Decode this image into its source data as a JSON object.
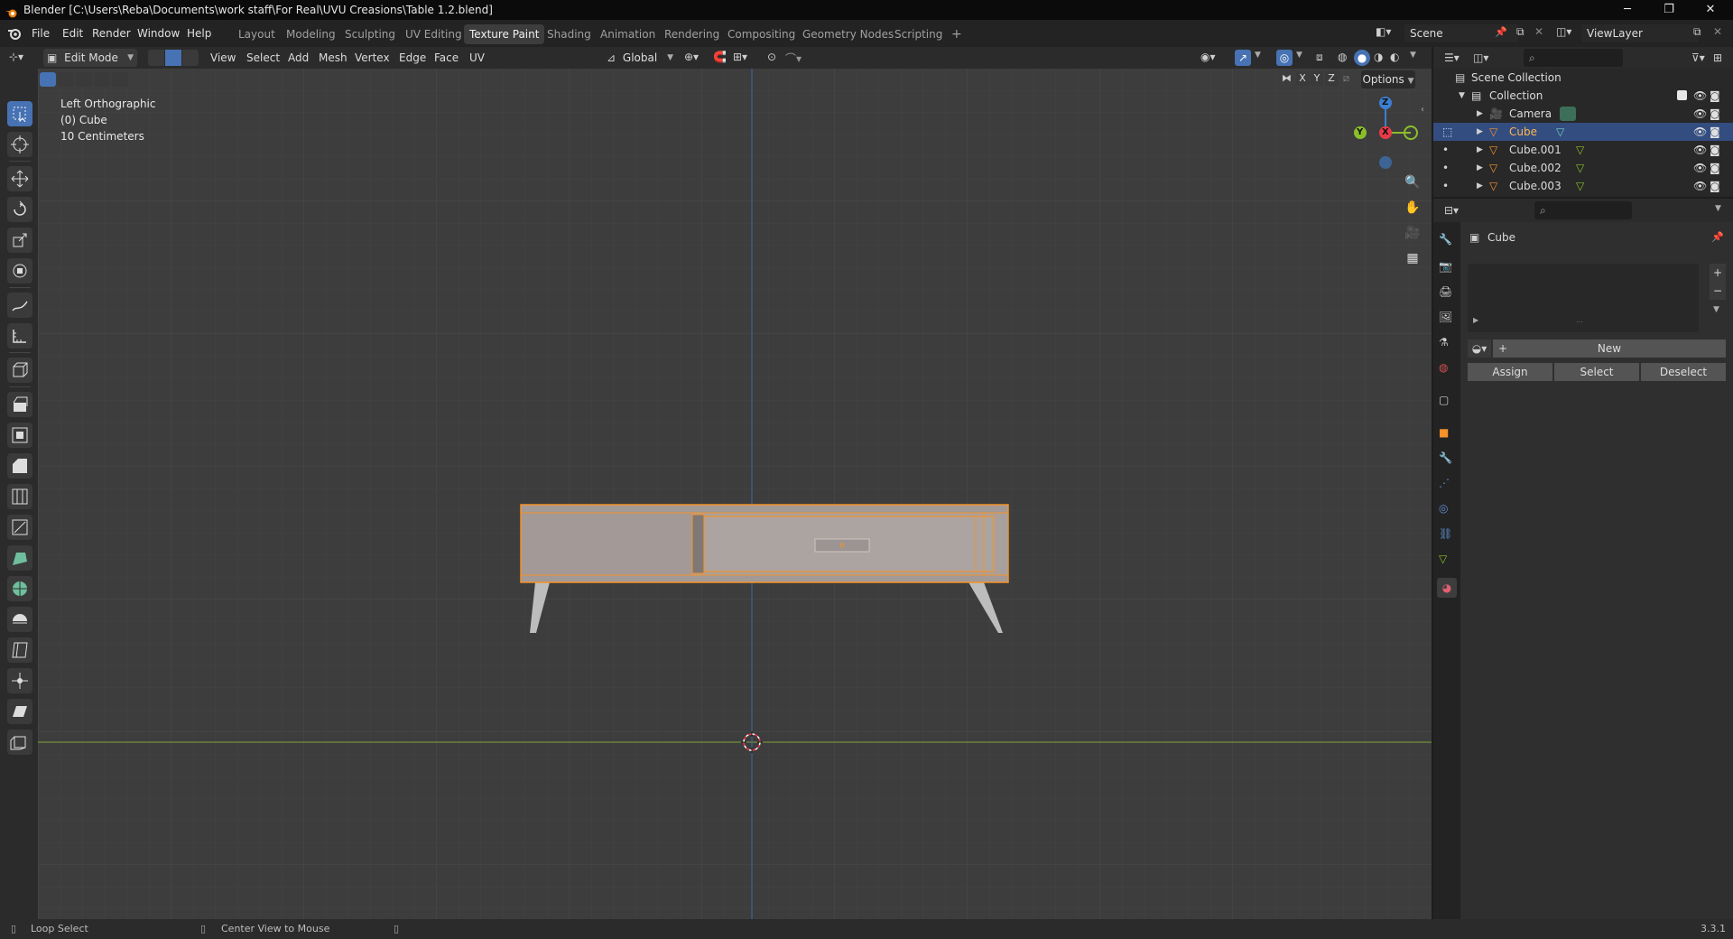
{
  "titlebar": {
    "title": "Blender [C:\\Users\\Reba\\Documents\\work staff\\For Real\\UVU Creasions\\Table 1.2.blend]"
  },
  "menu": [
    "File",
    "Edit",
    "Render",
    "Window",
    "Help"
  ],
  "workspaces": [
    "Layout",
    "Modeling",
    "Sculpting",
    "UV Editing",
    "Texture Paint",
    "Shading",
    "Animation",
    "Rendering",
    "Compositing",
    "Geometry Nodes",
    "Scripting"
  ],
  "active_workspace": "Texture Paint",
  "add_workspace": "+",
  "scene": {
    "name": "Scene",
    "viewlayer": "ViewLayer"
  },
  "viewport_header": {
    "mode": "Edit Mode",
    "menus": [
      "View",
      "Select",
      "Add",
      "Mesh",
      "Vertex",
      "Edge",
      "Face",
      "UV"
    ],
    "orientation": "Global",
    "options": "Options",
    "axes": [
      "X",
      "Y",
      "Z"
    ]
  },
  "overlay": {
    "view_name": "Left Orthographic",
    "object": "(0) Cube",
    "scale": "10 Centimeters"
  },
  "gizmo": {
    "z": "Z",
    "y": "Y",
    "x": "X"
  },
  "outliner": {
    "root": "Scene Collection",
    "collection": "Collection",
    "items": [
      {
        "name": "Camera",
        "type": "camera",
        "selected": false
      },
      {
        "name": "Cube",
        "type": "mesh",
        "selected": true
      },
      {
        "name": "Cube.001",
        "type": "mesh",
        "selected": false
      },
      {
        "name": "Cube.002",
        "type": "mesh",
        "selected": false
      },
      {
        "name": "Cube.003",
        "type": "mesh",
        "selected": false
      }
    ]
  },
  "properties": {
    "object_name": "Cube",
    "new_button": "New",
    "assign": "Assign",
    "select": "Select",
    "deselect": "Deselect",
    "add_slot": "+",
    "remove_slot": "−"
  },
  "statusbar": {
    "left": "Loop Select",
    "middle": "Center View to Mouse",
    "version": "3.3.1"
  },
  "colors": {
    "accent_blue": "#4772b3",
    "selection_orange": "#f5922a",
    "x_axis": "#e83a47",
    "y_axis": "#8bbf2a",
    "z_axis": "#3c7fd1",
    "viewport_bg": "#3d3d3d"
  }
}
